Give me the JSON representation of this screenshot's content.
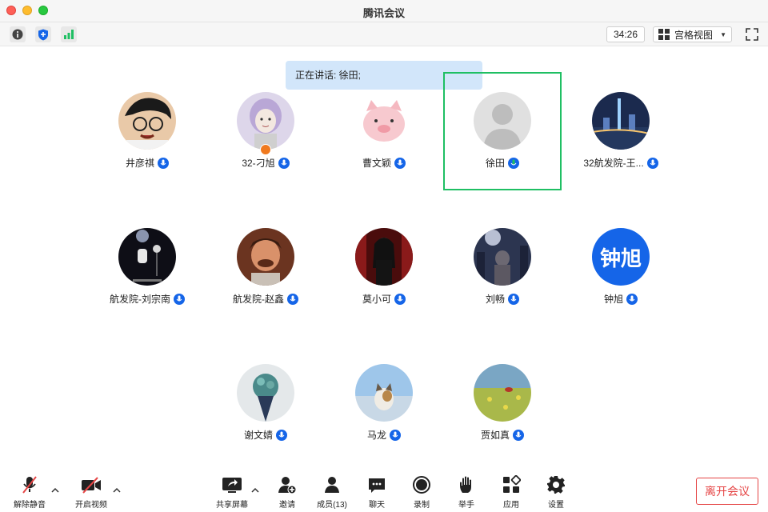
{
  "window": {
    "title": "腾讯会议"
  },
  "infobar": {
    "timer": "34:26",
    "view_mode": "宫格视图"
  },
  "speaker": {
    "text": "正在讲话: 徐田;"
  },
  "participants": [
    {
      "name": "井彦祺"
    },
    {
      "name": "32-刁旭"
    },
    {
      "name": "曹文颖"
    },
    {
      "name": "徐田"
    },
    {
      "name": "32航发院-王..."
    },
    {
      "name": "航发院-刘宗南"
    },
    {
      "name": "航发院-赵鑫"
    },
    {
      "name": "莫小可"
    },
    {
      "name": "刘畅"
    },
    {
      "name": "钟旭",
      "avatar_text": "钟旭"
    },
    {
      "name": "谢文婧"
    },
    {
      "name": "马龙"
    },
    {
      "name": "贾如真"
    }
  ],
  "toolbar": {
    "unmute": "解除静音",
    "start_video": "开启视频",
    "share_screen": "共享屏幕",
    "invite": "邀请",
    "members": "成员(13)",
    "chat": "聊天",
    "record": "录制",
    "raise_hand": "举手",
    "apps": "应用",
    "settings": "设置",
    "leave": "离开会议"
  },
  "colors": {
    "accent": "#1565e8",
    "active_border": "#1fbf63",
    "danger": "#e54545",
    "banner": "#d2e6fa"
  }
}
